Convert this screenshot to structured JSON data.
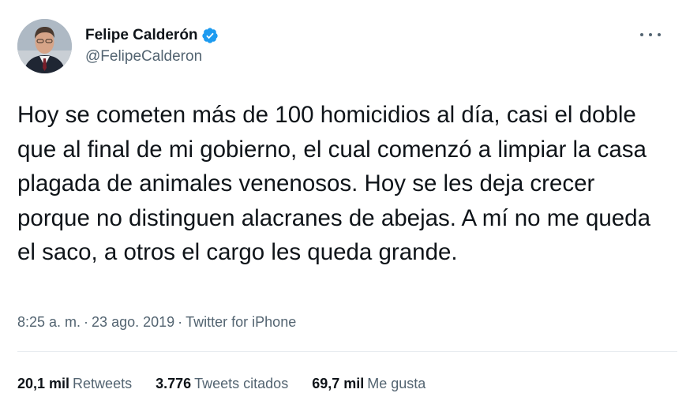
{
  "author": {
    "display_name": "Felipe Calderón",
    "handle": "@FelipeCalderon",
    "verified": true
  },
  "icons": {
    "verified": "verified-badge-icon",
    "more": "more-options-icon"
  },
  "tweet": {
    "text": "Hoy se cometen más de 100 homicidios al día, casi el doble que al final de mi gobierno, el cual comenzó a limpiar la casa plagada de animales venenosos. Hoy se les deja crecer porque no distinguen alacranes de abejas. A mí no me queda el saco, a otros el cargo les queda grande.",
    "time": "8:25 a. m.",
    "date": "23 ago. 2019",
    "source": "Twitter for iPhone",
    "separator": "·"
  },
  "stats": {
    "retweets_count": "20,1 mil",
    "retweets_label": "Retweets",
    "quotes_count": "3.776",
    "quotes_label": "Tweets citados",
    "likes_count": "69,7 mil",
    "likes_label": "Me gusta"
  },
  "colors": {
    "verified": "#1d9bf0",
    "secondary_text": "#536471",
    "primary_text": "#0f1419",
    "divider": "#e7ecf0"
  }
}
